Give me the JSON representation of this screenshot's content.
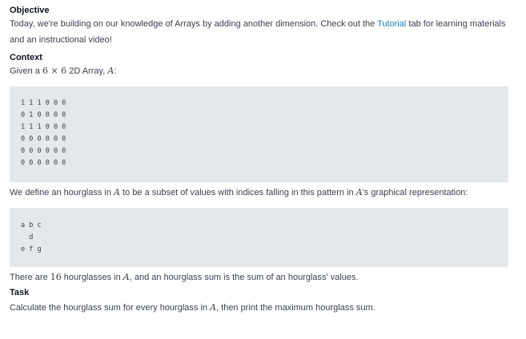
{
  "objective": {
    "heading": "Objective",
    "text_before_link": "Today, we're building on our knowledge of Arrays by adding another dimension. Check out the ",
    "link_label": "Tutorial",
    "text_after_link": " tab for learning materials and an instructional video!"
  },
  "context": {
    "heading": "Context",
    "given_prefix": "Given a ",
    "dimensions": "6 × 6",
    "array_type": " 2D Array, ",
    "array_name": "A",
    "given_suffix": ":"
  },
  "array_rows": [
    "1 1 1 0 0 0",
    "0 1 0 0 0 0",
    "1 1 1 0 0 0",
    "0 0 0 0 0 0",
    "0 0 0 0 0 0",
    "0 0 0 0 0 0"
  ],
  "define": {
    "text_before": "We define an hourglass in ",
    "var": "A",
    "text_middle": " to be a subset of values with indices falling in this pattern in ",
    "var2": "A",
    "text_after": "'s graphical representation:"
  },
  "hourglass_pattern": [
    "a b c",
    "  d",
    "e f g"
  ],
  "count": {
    "text_before": "There are ",
    "number": "16",
    "text_middle": " hourglasses in ",
    "var": "A",
    "text_after": ", and an hourglass sum is the sum of an hourglass' values."
  },
  "task": {
    "heading": "Task",
    "text_before": "Calculate the hourglass sum for every hourglass in ",
    "var": "A",
    "text_after": ", then print the maximum hourglass sum."
  }
}
